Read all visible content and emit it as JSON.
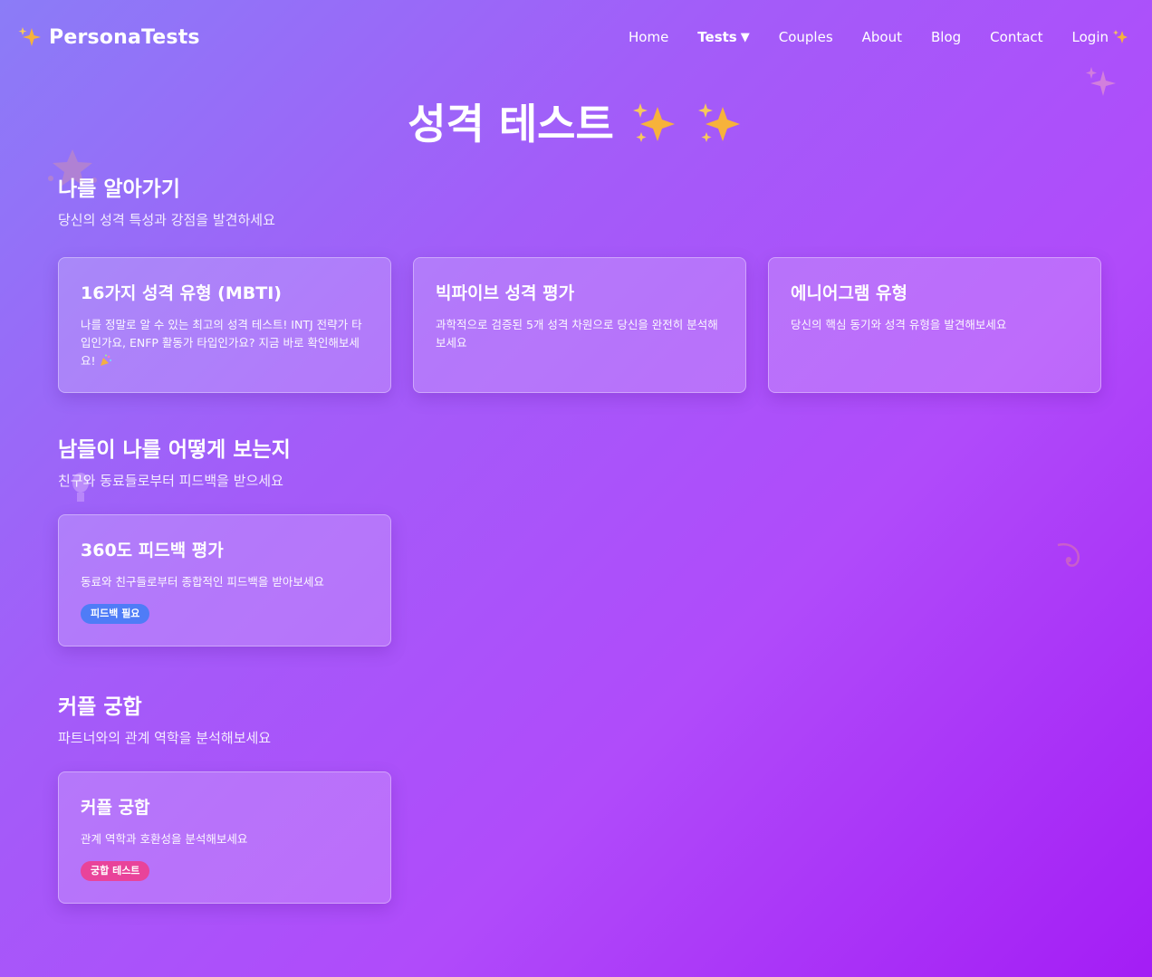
{
  "header": {
    "brand_name": "PersonaTests",
    "brand_icon": "sparkles-icon",
    "nav": {
      "home": "Home",
      "tests": "Tests",
      "tests_caret": "▼",
      "couples": "Couples",
      "about": "About",
      "blog": "Blog",
      "contact": "Contact",
      "login": "Login"
    }
  },
  "page": {
    "title": "성격 테스트"
  },
  "sections": [
    {
      "title": "나를 알아가기",
      "subtitle": "당신의 성격 특성과 강점을 발견하세요",
      "cards": [
        {
          "title": "16가지 성격 유형 (MBTI)",
          "description": "나를 정말로 알 수 있는 최고의 성격 테스트! INTJ 전략가 타입인가요, ENFP 활동가 타입인가요? 지금 바로 확인해보세요!",
          "trailing_icon": "confetti-icon"
        },
        {
          "title": "빅파이브 성격 평가",
          "description": "과학적으로 검증된 5개 성격 차원으로 당신을 완전히 분석해보세요"
        },
        {
          "title": "에니어그램 유형",
          "description": "당신의 핵심 동기와 성격 유형을 발견해보세요"
        }
      ]
    },
    {
      "title": "남들이 나를 어떻게 보는지",
      "subtitle": "친구와 동료들로부터 피드백을 받으세요",
      "cards": [
        {
          "title": "360도 피드백 평가",
          "description": "동료와 친구들로부터 종합적인 피드백을 받아보세요",
          "badge": "피드백 필요"
        }
      ]
    },
    {
      "title": "커플 궁합",
      "subtitle": "파트너와의 관계 역학을 분석해보세요",
      "cards": [
        {
          "title": "커플 궁합",
          "description": "관계 역학과 호환성을 분석해보세요",
          "badge": "궁합 테스트"
        }
      ]
    }
  ],
  "colors": {
    "badge_feedback": "#4f7cf7",
    "badge_compat": "#e9439a",
    "sparkle": "#f7b23b"
  }
}
